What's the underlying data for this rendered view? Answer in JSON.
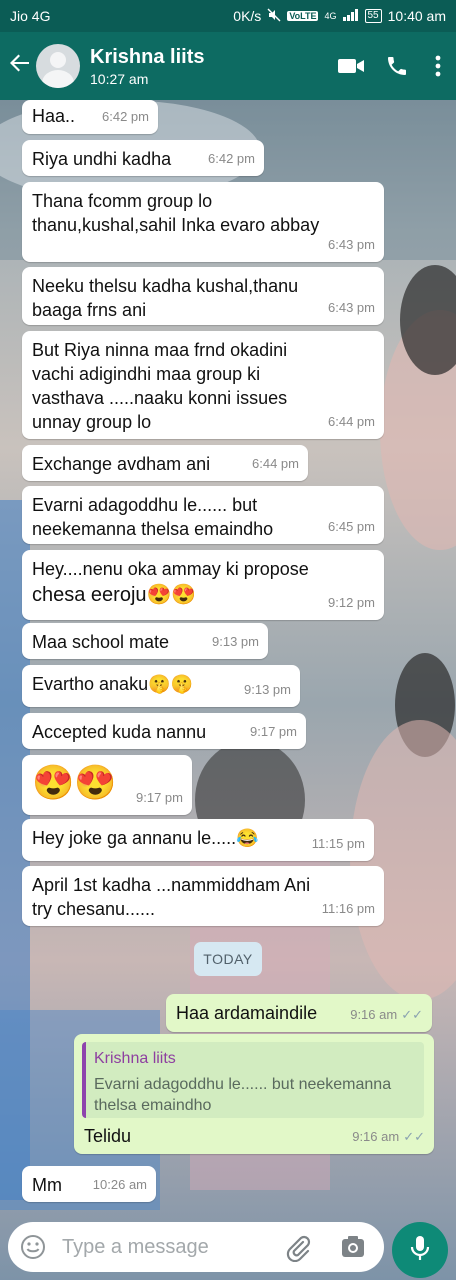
{
  "status_bar": {
    "carrier": "Jio 4G",
    "speed": "0K/s",
    "volte": "VoLTE",
    "network": "4G",
    "battery": "55",
    "clock": "10:40 am"
  },
  "header": {
    "contact_name": "Krishna liits",
    "last_seen": "10:27 am",
    "icons": [
      "back-arrow-icon",
      "avatar",
      "video-call-icon",
      "phone-icon",
      "menu-dots-icon"
    ]
  },
  "messages": [
    {
      "dir": "in",
      "text": "Haa..",
      "time": "6:42 pm"
    },
    {
      "dir": "in",
      "text": "Riya undhi kadha",
      "time": "6:42 pm"
    },
    {
      "dir": "in",
      "lines": [
        "Thana fcomm group lo",
        "thanu,kushal,sahil Inka evaro abbay"
      ],
      "time": "6:43 pm"
    },
    {
      "dir": "in",
      "lines": [
        "Neeku thelsu kadha kushal,thanu",
        "baaga frns ani"
      ],
      "time": "6:43 pm"
    },
    {
      "dir": "in",
      "lines": [
        "But Riya ninna maa frnd okadini",
        "vachi adigindhi maa group ki",
        "vasthava .....naaku konni issues",
        "unnay group lo"
      ],
      "time": "6:44 pm"
    },
    {
      "dir": "in",
      "text": "Exchange avdham ani",
      "time": "6:44 pm"
    },
    {
      "dir": "in",
      "lines": [
        "Evarni adagoddhu  le...... but",
        "neekemanna thelsa emaindho"
      ],
      "time": "6:45 pm"
    },
    {
      "dir": "in",
      "lines": [
        "Hey....nenu oka ammay ki propose",
        "chesa eeroju😍😍"
      ],
      "time": "9:12 pm"
    },
    {
      "dir": "in",
      "text": "Maa school mate",
      "time": "9:13 pm"
    },
    {
      "dir": "in",
      "text": "Evartho anaku🤫🤫",
      "time": "9:13 pm"
    },
    {
      "dir": "in",
      "text": "Accepted kuda nannu",
      "time": "9:17 pm"
    },
    {
      "dir": "in",
      "text": "😍😍",
      "time": "9:17 pm"
    },
    {
      "dir": "in",
      "text": "Hey joke ga annanu le.....😂",
      "time": "11:15 pm"
    },
    {
      "dir": "in",
      "lines": [
        "April 1st kadha ...nammiddham Ani",
        "try chesanu......"
      ],
      "time": "11:16 pm"
    },
    {
      "dir": "out",
      "text": "Haa ardamaindile",
      "time": "9:16 am"
    },
    {
      "dir": "out",
      "quote_name": "Krishna liits",
      "quote_lines": [
        "Evarni adagoddhu  le...... but neekemanna",
        "thelsa emaindho"
      ],
      "text": "Telidu",
      "time": "9:16 am"
    },
    {
      "dir": "in",
      "text": "Mm",
      "time": "10:26 am"
    }
  ],
  "date_separator": "TODAY",
  "input_bar": {
    "placeholder": "Type a message",
    "icons": [
      "emoji-icon",
      "attach-icon",
      "camera-icon",
      "mic-icon"
    ]
  },
  "colors": {
    "header": "#0d6b62",
    "status_bar": "#0b5c55",
    "outgoing_bubble": "#e2f8c8",
    "incoming_bubble": "#ffffff",
    "mic_button": "#0e8a77",
    "quote_accent": "#8e44ad"
  }
}
